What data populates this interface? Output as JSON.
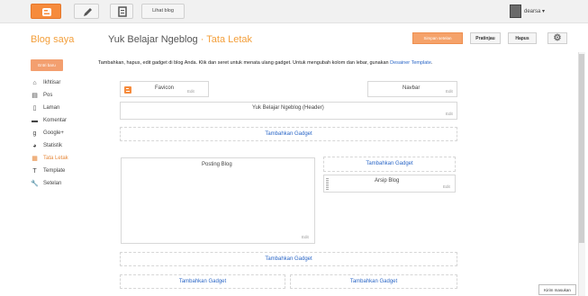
{
  "topbar": {
    "view_blog_label": "Lihat blog",
    "username": "dearsa",
    "colors": {
      "brand": "#f68b3c"
    }
  },
  "header": {
    "blog_title": "Blog saya",
    "page_title": "Yuk Belajar Ngeblog",
    "page_separator": "·",
    "page_section": "Tata Letak",
    "save_label": "Simpan setelan",
    "preview_label": "Pratinjau",
    "delete_label": "Hapus"
  },
  "sidebar": {
    "new_entry_label": "Entri baru",
    "items": [
      {
        "label": "Ikhtisar",
        "icon": "home-icon"
      },
      {
        "label": "Pos",
        "icon": "posts-icon"
      },
      {
        "label": "Laman",
        "icon": "pages-icon"
      },
      {
        "label": "Komentar",
        "icon": "comment-icon"
      },
      {
        "label": "Google+",
        "icon": "googleplus-icon"
      },
      {
        "label": "Statistik",
        "icon": "stats-icon"
      },
      {
        "label": "Tata Letak",
        "icon": "layout-icon",
        "active": true
      },
      {
        "label": "Template",
        "icon": "template-icon"
      },
      {
        "label": "Setelan",
        "icon": "wrench-icon"
      }
    ]
  },
  "main": {
    "intro_text": "Tambahkan, hapus, edit gadget di blog Anda. Klik dan seret untuk menata ulang gadget. Untuk mengubah kolom dan lebar, gunakan ",
    "intro_link": "Desainer Template",
    "intro_end": ".",
    "favicon_label": "Favicon",
    "navbar_label": "Navbar",
    "header_label": "Yuk Belajar Ngeblog (Header)",
    "post_label": "Posting Blog",
    "archive_label": "Arsip Blog",
    "edit_label": "Edit",
    "add_gadget_label": "Tambahkan Gadget"
  },
  "feedback_label": "Kirim masukan"
}
